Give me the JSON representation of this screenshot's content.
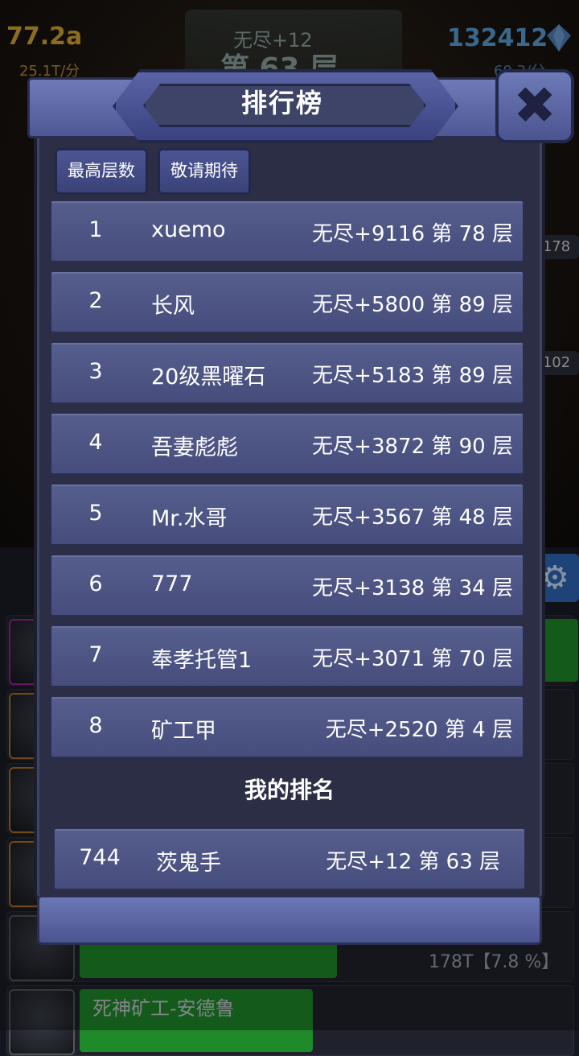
{
  "hud": {
    "gold": "77.2a",
    "gold_rate": "25.1T/分",
    "gems": "132412",
    "gems_rate": "69.3/分",
    "endless": "无尽+12",
    "floor": "第 63 层"
  },
  "side_badges": [
    "178",
    "102"
  ],
  "workers": {
    "stat": "178T【7.8 %】",
    "name": "死神矿工-安德鲁",
    "pct": "%】"
  },
  "modal": {
    "title": "排行榜",
    "tabs": [
      "最高层数",
      "敬请期待"
    ],
    "rows": [
      {
        "rank": "1",
        "name": "xuemo",
        "score": "无尽+9116 第 78 层"
      },
      {
        "rank": "2",
        "name": "长风",
        "score": "无尽+5800 第 89 层"
      },
      {
        "rank": "3",
        "name": "20级黑曜石",
        "score": "无尽+5183 第 89 层"
      },
      {
        "rank": "4",
        "name": "吾妻彪彪",
        "score": "无尽+3872 第 90 层"
      },
      {
        "rank": "5",
        "name": "Mr.水哥",
        "score": "无尽+3567 第 48 层"
      },
      {
        "rank": "6",
        "name": "777",
        "score": "无尽+3138 第 34 层"
      },
      {
        "rank": "7",
        "name": "奉孝托管1",
        "score": "无尽+3071 第 70 层"
      },
      {
        "rank": "8",
        "name": "矿工甲",
        "score": "无尽+2520 第 4 层"
      }
    ],
    "my_heading": "我的排名",
    "my_row": {
      "rank": "744",
      "name": "茨鬼手",
      "score": "无尽+12 第 63 层"
    }
  },
  "icons": {
    "close": "close-icon",
    "settings": "gear-icon",
    "gem": "gem-icon",
    "gold": "gold-coin-icon"
  },
  "colors": {
    "gold": "#d8a632",
    "gems": "#5aa0d8",
    "panel": "#2b2e45",
    "row": "#4d5586"
  }
}
